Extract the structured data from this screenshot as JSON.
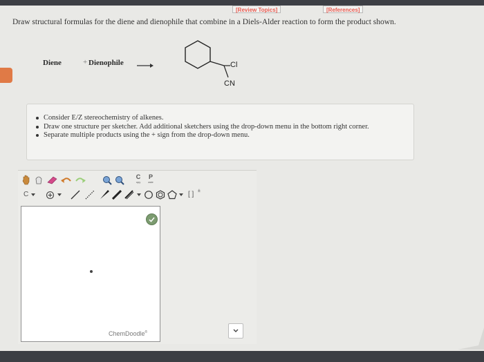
{
  "header": {
    "review_topics": "[Review Topics]",
    "references": "[References]"
  },
  "instruction": "Draw structural formulas for the diene and dienophile that combine in a Diels-Alder reaction to form the product shown.",
  "reaction": {
    "diene_label": "Diene",
    "plus": "+",
    "dienophile_label": "Dienophile",
    "product_substituents": {
      "cl": "Cl",
      "cn": "CN"
    }
  },
  "hints": [
    "Consider E/Z stereochemistry of alkenes.",
    "Draw one structure per sketcher. Add additional sketchers using the drop-down menu in the bottom right corner.",
    "Separate multiple products using the + sign from the drop-down menu."
  ],
  "sketcher": {
    "copy_label": "C",
    "copy_sub": "opy",
    "paste_label": "P",
    "paste_sub": "aste",
    "carbon_label": "C",
    "bracket_label": "[ ]",
    "bracket_sup": "±",
    "logo": "ChemDoodle",
    "logo_mark": "®"
  },
  "icons": {
    "hand": "hand-pan-icon",
    "lasso": "lasso-icon",
    "eraser": "eraser-icon",
    "undo": "undo-icon",
    "redo": "redo-icon",
    "zoom_in": "zoom-in-icon",
    "zoom_out": "zoom-out-icon",
    "charge": "charge-plus-icon",
    "check": "check-icon",
    "dropdown": "chevron-down-icon"
  },
  "colors": {
    "accent_orange": "#e07a46",
    "link_red": "#e85a4f",
    "check_green": "#7c9b70"
  }
}
